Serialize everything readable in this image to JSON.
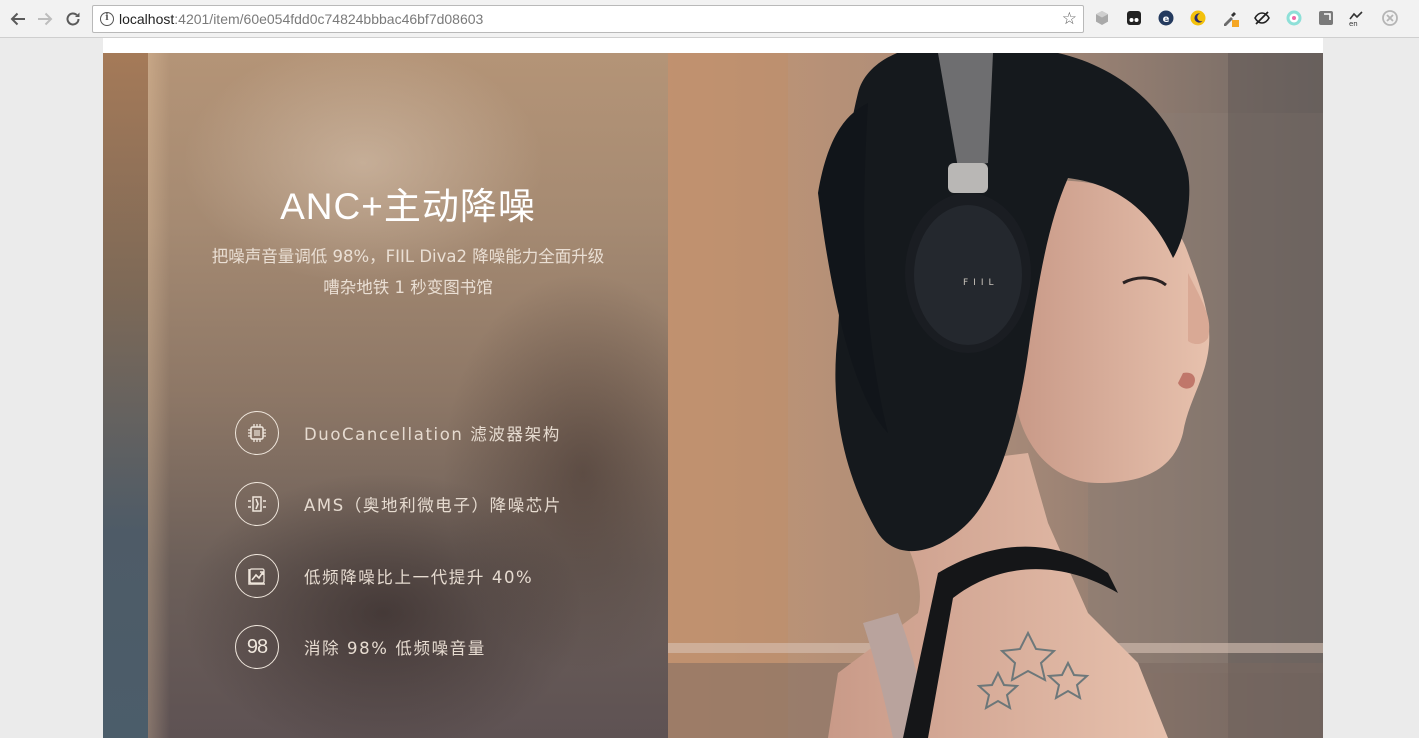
{
  "browser": {
    "url_host": "localhost",
    "url_path": ":4201/item/60e054fdd0c74824bbbac46bf7d08603",
    "back_icon": "arrow-left-icon",
    "forward_icon": "arrow-right-icon",
    "reload_icon": "reload-icon",
    "info_icon_glyph": "i",
    "bookmark_icon": "☆",
    "extensions": [
      {
        "name": "cube-extension-icon"
      },
      {
        "name": "tampermonkey-extension-icon"
      },
      {
        "name": "e-circle-extension-icon"
      },
      {
        "name": "moon-extension-icon"
      },
      {
        "name": "eyedropper-extension-icon"
      },
      {
        "name": "eye-slash-extension-icon"
      },
      {
        "name": "dots-circle-extension-icon"
      },
      {
        "name": "square-extension-icon"
      },
      {
        "name": "translate-en-extension-icon"
      },
      {
        "name": "close-circle-extension-icon"
      }
    ],
    "translate_label": "en"
  },
  "hero": {
    "title": "ANC+主动降噪",
    "subtitle_line1": "把噪声音量调低 98%，FIIL Diva2 降噪能力全面升级",
    "subtitle_line2": "嘈杂地铁 1 秒变图书馆",
    "features": [
      {
        "icon": "chip-icon",
        "text": "DuoCancellation 滤波器架构"
      },
      {
        "icon": "noise-chip-icon",
        "text": "AMS（奥地利微电子）降噪芯片"
      },
      {
        "icon": "trend-chart-icon",
        "text": "低频降噪比上一代提升 40%"
      },
      {
        "icon": "number-98-icon",
        "icon_text": "98",
        "text": "消除 98% 低频噪音量"
      }
    ],
    "headphone_brand": "FIIL"
  }
}
